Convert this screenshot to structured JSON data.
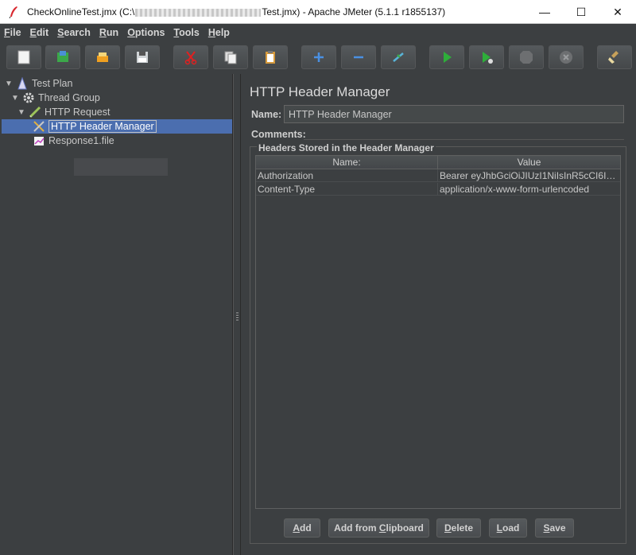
{
  "window": {
    "title_prefix": "CheckOnlineTest.jmx (C:\\",
    "title_suffix": "Test.jmx) - Apache JMeter (5.1.1 r1855137)",
    "minimize": "—",
    "maximize": "☐",
    "close": "✕"
  },
  "menu": [
    {
      "mnemonic": "F",
      "rest": "ile"
    },
    {
      "mnemonic": "E",
      "rest": "dit"
    },
    {
      "mnemonic": "S",
      "rest": "earch"
    },
    {
      "mnemonic": "R",
      "rest": "un"
    },
    {
      "mnemonic": "O",
      "rest": "ptions"
    },
    {
      "mnemonic": "T",
      "rest": "ools"
    },
    {
      "mnemonic": "H",
      "rest": "elp"
    }
  ],
  "toolbar": {
    "icons": [
      "new-icon",
      "templates-icon",
      "open-icon",
      "save-icon",
      "cut-icon",
      "copy-icon",
      "paste-icon",
      "expand-icon",
      "collapse-icon",
      "toggle-icon",
      "start-icon",
      "start-no-pause-icon",
      "stop-icon",
      "shutdown-icon",
      "clear-all-icon"
    ]
  },
  "tree": {
    "test_plan": "Test Plan",
    "thread_group": "Thread Group",
    "http_request": "HTTP Request",
    "header_manager": "HTTP Header Manager",
    "response_file": "Response1.file"
  },
  "panel": {
    "title": "HTTP Header Manager",
    "name_label": "Name:",
    "name_value": "HTTP Header Manager",
    "comments_label": "Comments:",
    "headers_legend": "Headers Stored in the Header Manager",
    "columns": [
      "Name:",
      "Value"
    ],
    "rows": [
      {
        "name": "Authorization",
        "value": "Bearer eyJhbGciOiJIUzI1NiIsInR5cCI6Ikp..."
      },
      {
        "name": "Content-Type",
        "value": "application/x-www-form-urlencoded"
      }
    ]
  },
  "buttons": {
    "add": {
      "mnemonic": "A",
      "rest": "dd"
    },
    "add_clipboard": {
      "pre": "Add from ",
      "mnemonic": "C",
      "rest": "lipboard"
    },
    "delete": {
      "mnemonic": "D",
      "rest": "elete"
    },
    "load": {
      "mnemonic": "L",
      "rest": "oad"
    },
    "save": {
      "mnemonic": "S",
      "rest": "ave"
    }
  }
}
